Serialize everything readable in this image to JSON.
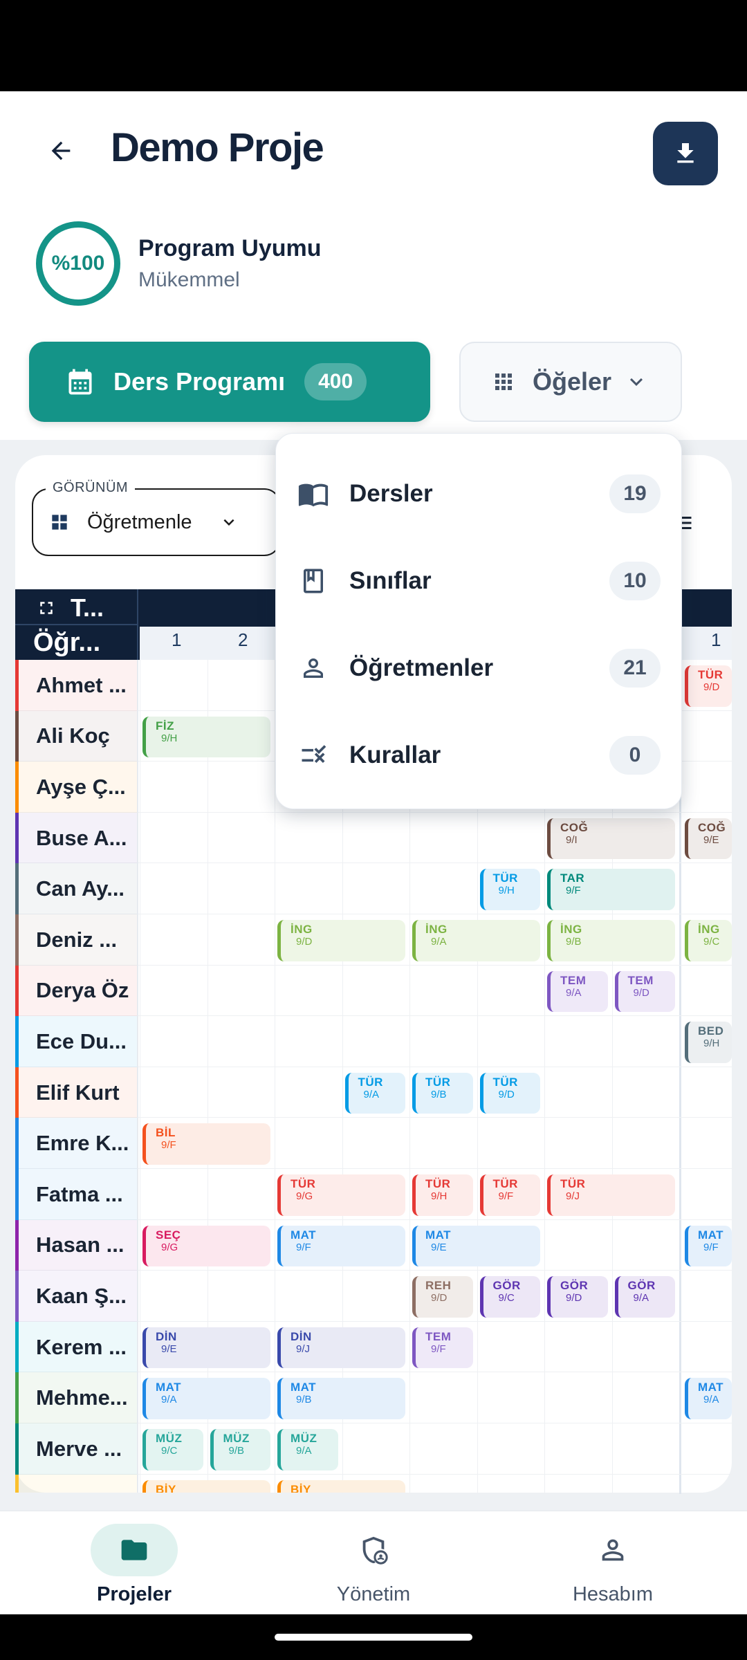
{
  "header": {
    "title": "Demo Proje"
  },
  "score": {
    "value": "%100",
    "title": "Program Uyumu",
    "subtitle": "Mükemmel"
  },
  "schedule_button": {
    "label": "Ders Programı",
    "count": "400"
  },
  "items_button": {
    "label": "Öğeler"
  },
  "view": {
    "legend": "GÖRÜNÜM",
    "value": "Öğretmenle"
  },
  "grid": {
    "corner_top": "T...",
    "corner_bottom": "Öğr...",
    "periods": [
      "1",
      "2",
      "1"
    ]
  },
  "teachers": [
    {
      "name": "Ahmet ...",
      "color": "#e53935"
    },
    {
      "name": "Ali Koç",
      "color": "#6d4c41"
    },
    {
      "name": "Ayşe Ç...",
      "color": "#fb8c00"
    },
    {
      "name": "Buse A...",
      "color": "#5e35b1"
    },
    {
      "name": "Can Ay...",
      "color": "#546e7a"
    },
    {
      "name": "Deniz ...",
      "color": "#8d6e63"
    },
    {
      "name": "Derya Öz",
      "color": "#e53935"
    },
    {
      "name": "Ece Du...",
      "color": "#039be5"
    },
    {
      "name": "Elif Kurt",
      "color": "#f4511e"
    },
    {
      "name": "Emre K...",
      "color": "#1e88e5"
    },
    {
      "name": "Fatma ...",
      "color": "#1e88e5"
    },
    {
      "name": "Hasan ...",
      "color": "#8e24aa"
    },
    {
      "name": "Kaan Ş...",
      "color": "#7e57c2"
    },
    {
      "name": "Kerem ...",
      "color": "#00acc1"
    },
    {
      "name": "Mehme...",
      "color": "#43a047"
    },
    {
      "name": "Merve ...",
      "color": "#00897b"
    },
    {
      "name": "",
      "color": "#fbc02d"
    }
  ],
  "lessons": [
    {
      "row": 0,
      "col": 8,
      "span": 1,
      "subject": "TÜR",
      "class": "9/D",
      "color": "#e53935",
      "bg": "#fdecea"
    },
    {
      "row": 1,
      "col": 0,
      "span": 2,
      "subject": "FİZ",
      "class": "9/H",
      "color": "#43a047",
      "bg": "#e8f3e8"
    },
    {
      "row": 3,
      "col": 6,
      "span": 2,
      "subject": "COĞ",
      "class": "9/I",
      "color": "#6d4c41",
      "bg": "#efebe9"
    },
    {
      "row": 3,
      "col": 8,
      "span": 1,
      "subject": "COĞ",
      "class": "9/E",
      "color": "#6d4c41",
      "bg": "#efebe9"
    },
    {
      "row": 4,
      "col": 5,
      "span": 1,
      "subject": "TÜR",
      "class": "9/H",
      "color": "#039be5",
      "bg": "#e3f2fb"
    },
    {
      "row": 4,
      "col": 6,
      "span": 2,
      "subject": "TAR",
      "class": "9/F",
      "color": "#00897b",
      "bg": "#e0f2f0"
    },
    {
      "row": 5,
      "col": 2,
      "span": 2,
      "subject": "İNG",
      "class": "9/D",
      "color": "#7cb342",
      "bg": "#eef6e6"
    },
    {
      "row": 5,
      "col": 4,
      "span": 2,
      "subject": "İNG",
      "class": "9/A",
      "color": "#7cb342",
      "bg": "#eef6e6"
    },
    {
      "row": 5,
      "col": 6,
      "span": 2,
      "subject": "İNG",
      "class": "9/B",
      "color": "#7cb342",
      "bg": "#eef6e6"
    },
    {
      "row": 5,
      "col": 8,
      "span": 1,
      "subject": "İNG",
      "class": "9/C",
      "color": "#7cb342",
      "bg": "#eef6e6"
    },
    {
      "row": 6,
      "col": 6,
      "span": 1,
      "subject": "TEM",
      "class": "9/A",
      "color": "#7e57c2",
      "bg": "#efe9f8"
    },
    {
      "row": 6,
      "col": 7,
      "span": 1,
      "subject": "TEM",
      "class": "9/D",
      "color": "#7e57c2",
      "bg": "#efe9f8"
    },
    {
      "row": 7,
      "col": 8,
      "span": 1,
      "subject": "BED",
      "class": "9/H",
      "color": "#546e7a",
      "bg": "#eceff1"
    },
    {
      "row": 8,
      "col": 3,
      "span": 1,
      "subject": "TÜR",
      "class": "9/A",
      "color": "#039be5",
      "bg": "#e3f2fb"
    },
    {
      "row": 8,
      "col": 4,
      "span": 1,
      "subject": "TÜR",
      "class": "9/B",
      "color": "#039be5",
      "bg": "#e3f2fb"
    },
    {
      "row": 8,
      "col": 5,
      "span": 1,
      "subject": "TÜR",
      "class": "9/D",
      "color": "#039be5",
      "bg": "#e3f2fb"
    },
    {
      "row": 9,
      "col": 0,
      "span": 2,
      "subject": "BİL",
      "class": "9/F",
      "color": "#f4511e",
      "bg": "#fdece5"
    },
    {
      "row": 10,
      "col": 2,
      "span": 2,
      "subject": "TÜR",
      "class": "9/G",
      "color": "#e53935",
      "bg": "#fdecea"
    },
    {
      "row": 10,
      "col": 4,
      "span": 1,
      "subject": "TÜR",
      "class": "9/H",
      "color": "#e53935",
      "bg": "#fdecea"
    },
    {
      "row": 10,
      "col": 5,
      "span": 1,
      "subject": "TÜR",
      "class": "9/F",
      "color": "#e53935",
      "bg": "#fdecea"
    },
    {
      "row": 10,
      "col": 6,
      "span": 2,
      "subject": "TÜR",
      "class": "9/J",
      "color": "#e53935",
      "bg": "#fdecea"
    },
    {
      "row": 11,
      "col": 0,
      "span": 2,
      "subject": "SEÇ",
      "class": "9/G",
      "color": "#d81b60",
      "bg": "#fce7ee"
    },
    {
      "row": 11,
      "col": 2,
      "span": 2,
      "subject": "MAT",
      "class": "9/F",
      "color": "#1e88e5",
      "bg": "#e5f0fb"
    },
    {
      "row": 11,
      "col": 4,
      "span": 2,
      "subject": "MAT",
      "class": "9/E",
      "color": "#1e88e5",
      "bg": "#e5f0fb"
    },
    {
      "row": 11,
      "col": 8,
      "span": 1,
      "subject": "MAT",
      "class": "9/F",
      "color": "#1e88e5",
      "bg": "#e5f0fb"
    },
    {
      "row": 12,
      "col": 4,
      "span": 1,
      "subject": "REH",
      "class": "9/D",
      "color": "#8d6e63",
      "bg": "#f1ece9"
    },
    {
      "row": 12,
      "col": 5,
      "span": 1,
      "subject": "GÖR",
      "class": "9/C",
      "color": "#5e35b1",
      "bg": "#ede7f6"
    },
    {
      "row": 12,
      "col": 6,
      "span": 1,
      "subject": "GÖR",
      "class": "9/D",
      "color": "#5e35b1",
      "bg": "#ede7f6"
    },
    {
      "row": 12,
      "col": 7,
      "span": 1,
      "subject": "GÖR",
      "class": "9/A",
      "color": "#5e35b1",
      "bg": "#ede7f6"
    },
    {
      "row": 13,
      "col": 0,
      "span": 2,
      "subject": "DİN",
      "class": "9/E",
      "color": "#3949ab",
      "bg": "#e9eaf5"
    },
    {
      "row": 13,
      "col": 2,
      "span": 2,
      "subject": "DİN",
      "class": "9/J",
      "color": "#3949ab",
      "bg": "#e9eaf5"
    },
    {
      "row": 13,
      "col": 4,
      "span": 1,
      "subject": "TEM",
      "class": "9/F",
      "color": "#7e57c2",
      "bg": "#efe9f8"
    },
    {
      "row": 14,
      "col": 0,
      "span": 2,
      "subject": "MAT",
      "class": "9/A",
      "color": "#1e88e5",
      "bg": "#e5f0fb"
    },
    {
      "row": 14,
      "col": 2,
      "span": 2,
      "subject": "MAT",
      "class": "9/B",
      "color": "#1e88e5",
      "bg": "#e5f0fb"
    },
    {
      "row": 14,
      "col": 8,
      "span": 1,
      "subject": "MAT",
      "class": "9/A",
      "color": "#1e88e5",
      "bg": "#e5f0fb"
    },
    {
      "row": 15,
      "col": 0,
      "span": 1,
      "subject": "MÜZ",
      "class": "9/C",
      "color": "#26a69a",
      "bg": "#e3f4f1"
    },
    {
      "row": 15,
      "col": 1,
      "span": 1,
      "subject": "MÜZ",
      "class": "9/B",
      "color": "#26a69a",
      "bg": "#e3f4f1"
    },
    {
      "row": 15,
      "col": 2,
      "span": 1,
      "subject": "MÜZ",
      "class": "9/A",
      "color": "#26a69a",
      "bg": "#e3f4f1"
    },
    {
      "row": 16,
      "col": 0,
      "span": 2,
      "subject": "BİY",
      "class": "",
      "color": "#fb8c00",
      "bg": "#fdf0e0"
    },
    {
      "row": 16,
      "col": 2,
      "span": 2,
      "subject": "BİY",
      "class": "",
      "color": "#fb8c00",
      "bg": "#fdf0e0"
    }
  ],
  "dropdown": {
    "items": [
      {
        "label": "Dersler",
        "count": "19",
        "icon": "book-open-icon"
      },
      {
        "label": "Sınıflar",
        "count": "10",
        "icon": "bookmark-book-icon"
      },
      {
        "label": "Öğretmenler",
        "count": "21",
        "icon": "person-icon"
      },
      {
        "label": "Kurallar",
        "count": "0",
        "icon": "rules-checklist-icon"
      }
    ]
  },
  "bottom_nav": {
    "items": [
      {
        "label": "Projeler",
        "icon": "folder-icon",
        "active": true
      },
      {
        "label": "Yönetim",
        "icon": "shield-person-icon",
        "active": false
      },
      {
        "label": "Hesabım",
        "icon": "account-icon",
        "active": false
      }
    ]
  },
  "colors": {
    "primary": "#149488",
    "navy": "#1d3557",
    "header_dark": "#102038"
  }
}
